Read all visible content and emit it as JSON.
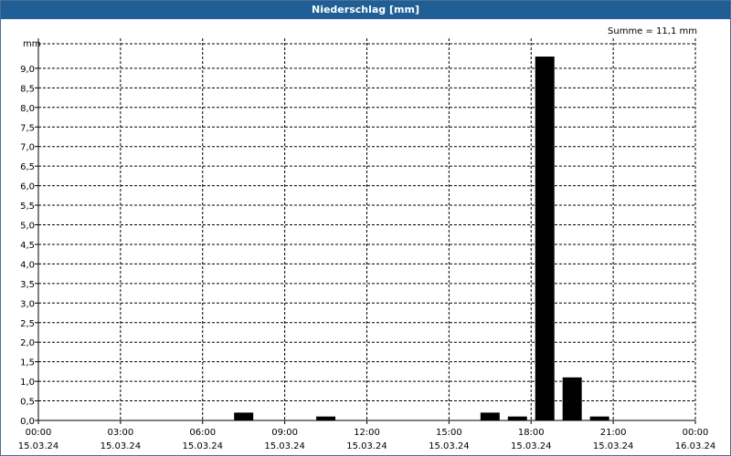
{
  "window": {
    "title": "Niederschlag [mm]"
  },
  "chart_data": {
    "type": "bar",
    "title": "Niederschlag [mm]",
    "ylabel": "mm",
    "ylim": [
      0,
      9.0
    ],
    "y_ticks": [
      "0,0",
      "0,5",
      "1,0",
      "1,5",
      "2,0",
      "2,5",
      "3,0",
      "3,5",
      "4,0",
      "4,5",
      "5,0",
      "5,5",
      "6,0",
      "6,5",
      "7,0",
      "7,5",
      "8,0",
      "8,5",
      "9,0"
    ],
    "x_ticks": [
      {
        "time": "00:00",
        "date": "15.03.24"
      },
      {
        "time": "03:00",
        "date": "15.03.24"
      },
      {
        "time": "06:00",
        "date": "15.03.24"
      },
      {
        "time": "09:00",
        "date": "15.03.24"
      },
      {
        "time": "12:00",
        "date": "15.03.24"
      },
      {
        "time": "15:00",
        "date": "15.03.24"
      },
      {
        "time": "18:00",
        "date": "15.03.24"
      },
      {
        "time": "21:00",
        "date": "15.03.24"
      },
      {
        "time": "00:00",
        "date": "16.03.24"
      }
    ],
    "annotation": "Summe = 11,1 mm",
    "grid": true,
    "bar_color": "#000000",
    "categories": [
      "07:00-08:00",
      "10:00-11:00",
      "16:00-17:00",
      "17:00-18:00",
      "18:00-19:00",
      "19:00-20:00",
      "20:00-21:00"
    ],
    "bars": [
      {
        "start_hour": 7,
        "end_hour": 8,
        "value": 0.2
      },
      {
        "start_hour": 10,
        "end_hour": 11,
        "value": 0.1
      },
      {
        "start_hour": 16,
        "end_hour": 17,
        "value": 0.2
      },
      {
        "start_hour": 17,
        "end_hour": 18,
        "value": 0.1
      },
      {
        "start_hour": 18,
        "end_hour": 19,
        "value": 9.3
      },
      {
        "start_hour": 19,
        "end_hour": 20,
        "value": 1.1
      },
      {
        "start_hour": 20,
        "end_hour": 21,
        "value": 0.1
      }
    ]
  }
}
